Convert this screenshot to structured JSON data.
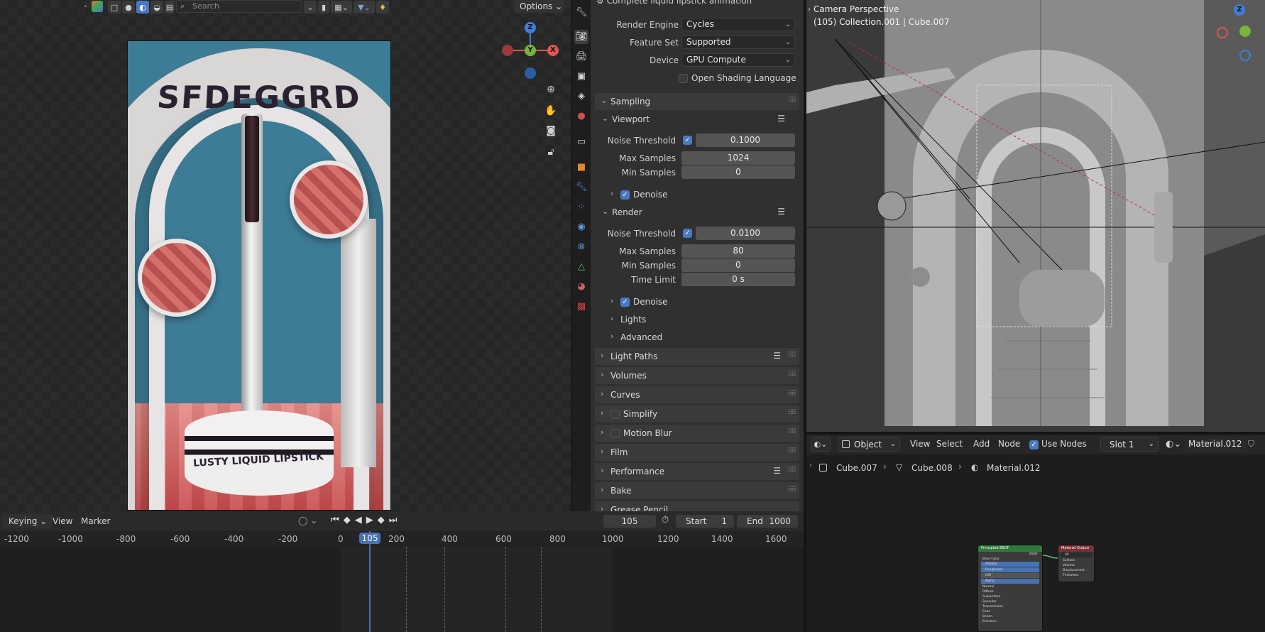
{
  "image_editor": {
    "search_placeholder": "Search",
    "options_label": "Options",
    "poster": {
      "brand_text": "SFDEGGRD",
      "base_label": "LUSTY LIQUID LIPSTICK"
    },
    "gizmo": {
      "z": "Z",
      "y": "Y",
      "x": "X"
    }
  },
  "properties": {
    "header_title": "Complete liquid lipstick animation",
    "render_engine": {
      "label": "Render Engine",
      "value": "Cycles"
    },
    "feature_set": {
      "label": "Feature Set",
      "value": "Supported"
    },
    "device": {
      "label": "Device",
      "value": "GPU Compute"
    },
    "osl": {
      "label": "Open Shading Language",
      "checked": false
    },
    "sampling": {
      "title": "Sampling",
      "viewport": {
        "title": "Viewport",
        "noise_threshold_label": "Noise Threshold",
        "noise_threshold_value": "0.1000",
        "max_samples_label": "Max Samples",
        "max_samples_value": "1024",
        "min_samples_label": "Min Samples",
        "min_samples_value": "0",
        "denoise_label": "Denoise"
      },
      "render": {
        "title": "Render",
        "noise_threshold_label": "Noise Threshold",
        "noise_threshold_value": "0.0100",
        "max_samples_label": "Max Samples",
        "max_samples_value": "80",
        "min_samples_label": "Min Samples",
        "min_samples_value": "0",
        "time_limit_label": "Time Limit",
        "time_limit_value": "0 s",
        "denoise_label": "Denoise"
      },
      "lights": "Lights",
      "advanced": "Advanced"
    },
    "panels": [
      "Light Paths",
      "Volumes",
      "Curves",
      "Simplify",
      "Motion Blur",
      "Film",
      "Performance",
      "Bake",
      "Grease Pencil"
    ]
  },
  "timeline": {
    "keying": "Keying",
    "view": "View",
    "marker": "Marker",
    "current_frame": "105",
    "start_label": "Start",
    "start_value": "1",
    "end_label": "End",
    "end_value": "1000",
    "ticks": [
      "-1200",
      "-1000",
      "-800",
      "-600",
      "-400",
      "-200",
      "0",
      "105",
      "200",
      "400",
      "600",
      "800",
      "1000",
      "1200",
      "1400",
      "1600"
    ]
  },
  "viewport3d": {
    "title": "Camera Perspective",
    "subtitle": "(105) Collection.001 | Cube.007",
    "gizmo_z": "Z"
  },
  "node_editor": {
    "editor_type": "Object",
    "menu": [
      "View",
      "Select",
      "Add",
      "Node"
    ],
    "use_nodes_label": "Use Nodes",
    "slot": "Slot 1",
    "material": "Material.012",
    "breadcrumbs": [
      "Cube.007",
      "Cube.008",
      "Material.012"
    ],
    "node_bsdf": {
      "title": "Principled BSDF",
      "rows": [
        "BSDF",
        "Base Color",
        "Metallic",
        "Roughness",
        "IOR",
        "Alpha",
        "Normal",
        "Diffuse",
        "Subsurface",
        "Specular",
        "Transmission",
        "Coat",
        "Sheen",
        "Emission"
      ]
    },
    "node_output": {
      "title": "Material Output",
      "rows": [
        "All",
        "Surface",
        "Volume",
        "Displacement",
        "Thickness"
      ]
    }
  },
  "colors": {
    "accent": "#4a78c2",
    "frame_marker": "#4772b3",
    "gizmo_x": "#e05454",
    "gizmo_y": "#7ab33a",
    "gizmo_z": "#3d7fd6"
  }
}
